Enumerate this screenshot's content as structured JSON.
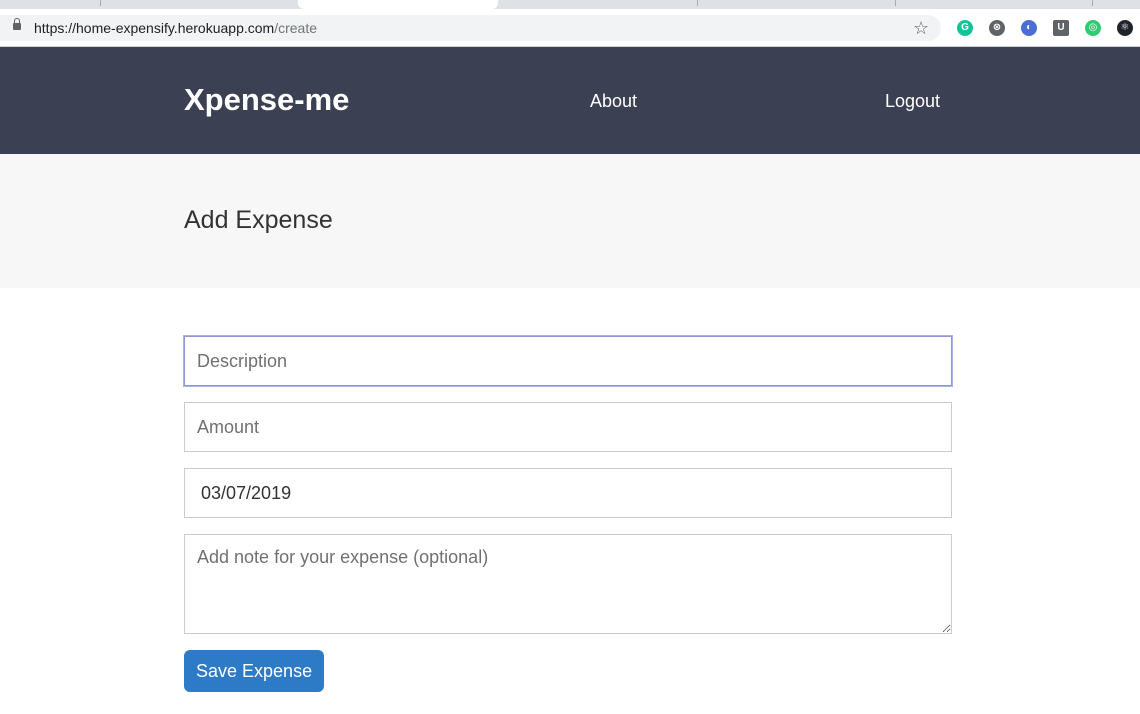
{
  "browser": {
    "url_host": "https://home-expensify.herokuapp.com",
    "url_path": "/create",
    "extensions": [
      {
        "name": "grammarly-icon",
        "color": "#15c39a",
        "glyph": "G"
      },
      {
        "name": "extension-icon",
        "color": "#5f6368",
        "glyph": "⊗"
      },
      {
        "name": "extension-icon",
        "color": "#4a6fd4",
        "glyph": "◐"
      },
      {
        "name": "ublock-icon",
        "color": "#5f6368",
        "glyph": "U"
      },
      {
        "name": "extension-icon",
        "color": "#2ecc71",
        "glyph": "◎"
      },
      {
        "name": "react-devtools-icon",
        "color": "#20232a",
        "glyph": "⚛"
      }
    ]
  },
  "header": {
    "brand": "Xpense-me",
    "about": "About",
    "logout": "Logout",
    "bg_color": "#3c4053"
  },
  "page": {
    "title": "Add Expense"
  },
  "form": {
    "description_placeholder": "Description",
    "amount_placeholder": "Amount",
    "date_value": "03/07/2019",
    "note_placeholder": "Add note for your expense (optional)",
    "save_label": "Save Expense",
    "button_color": "#2d7ac6"
  }
}
